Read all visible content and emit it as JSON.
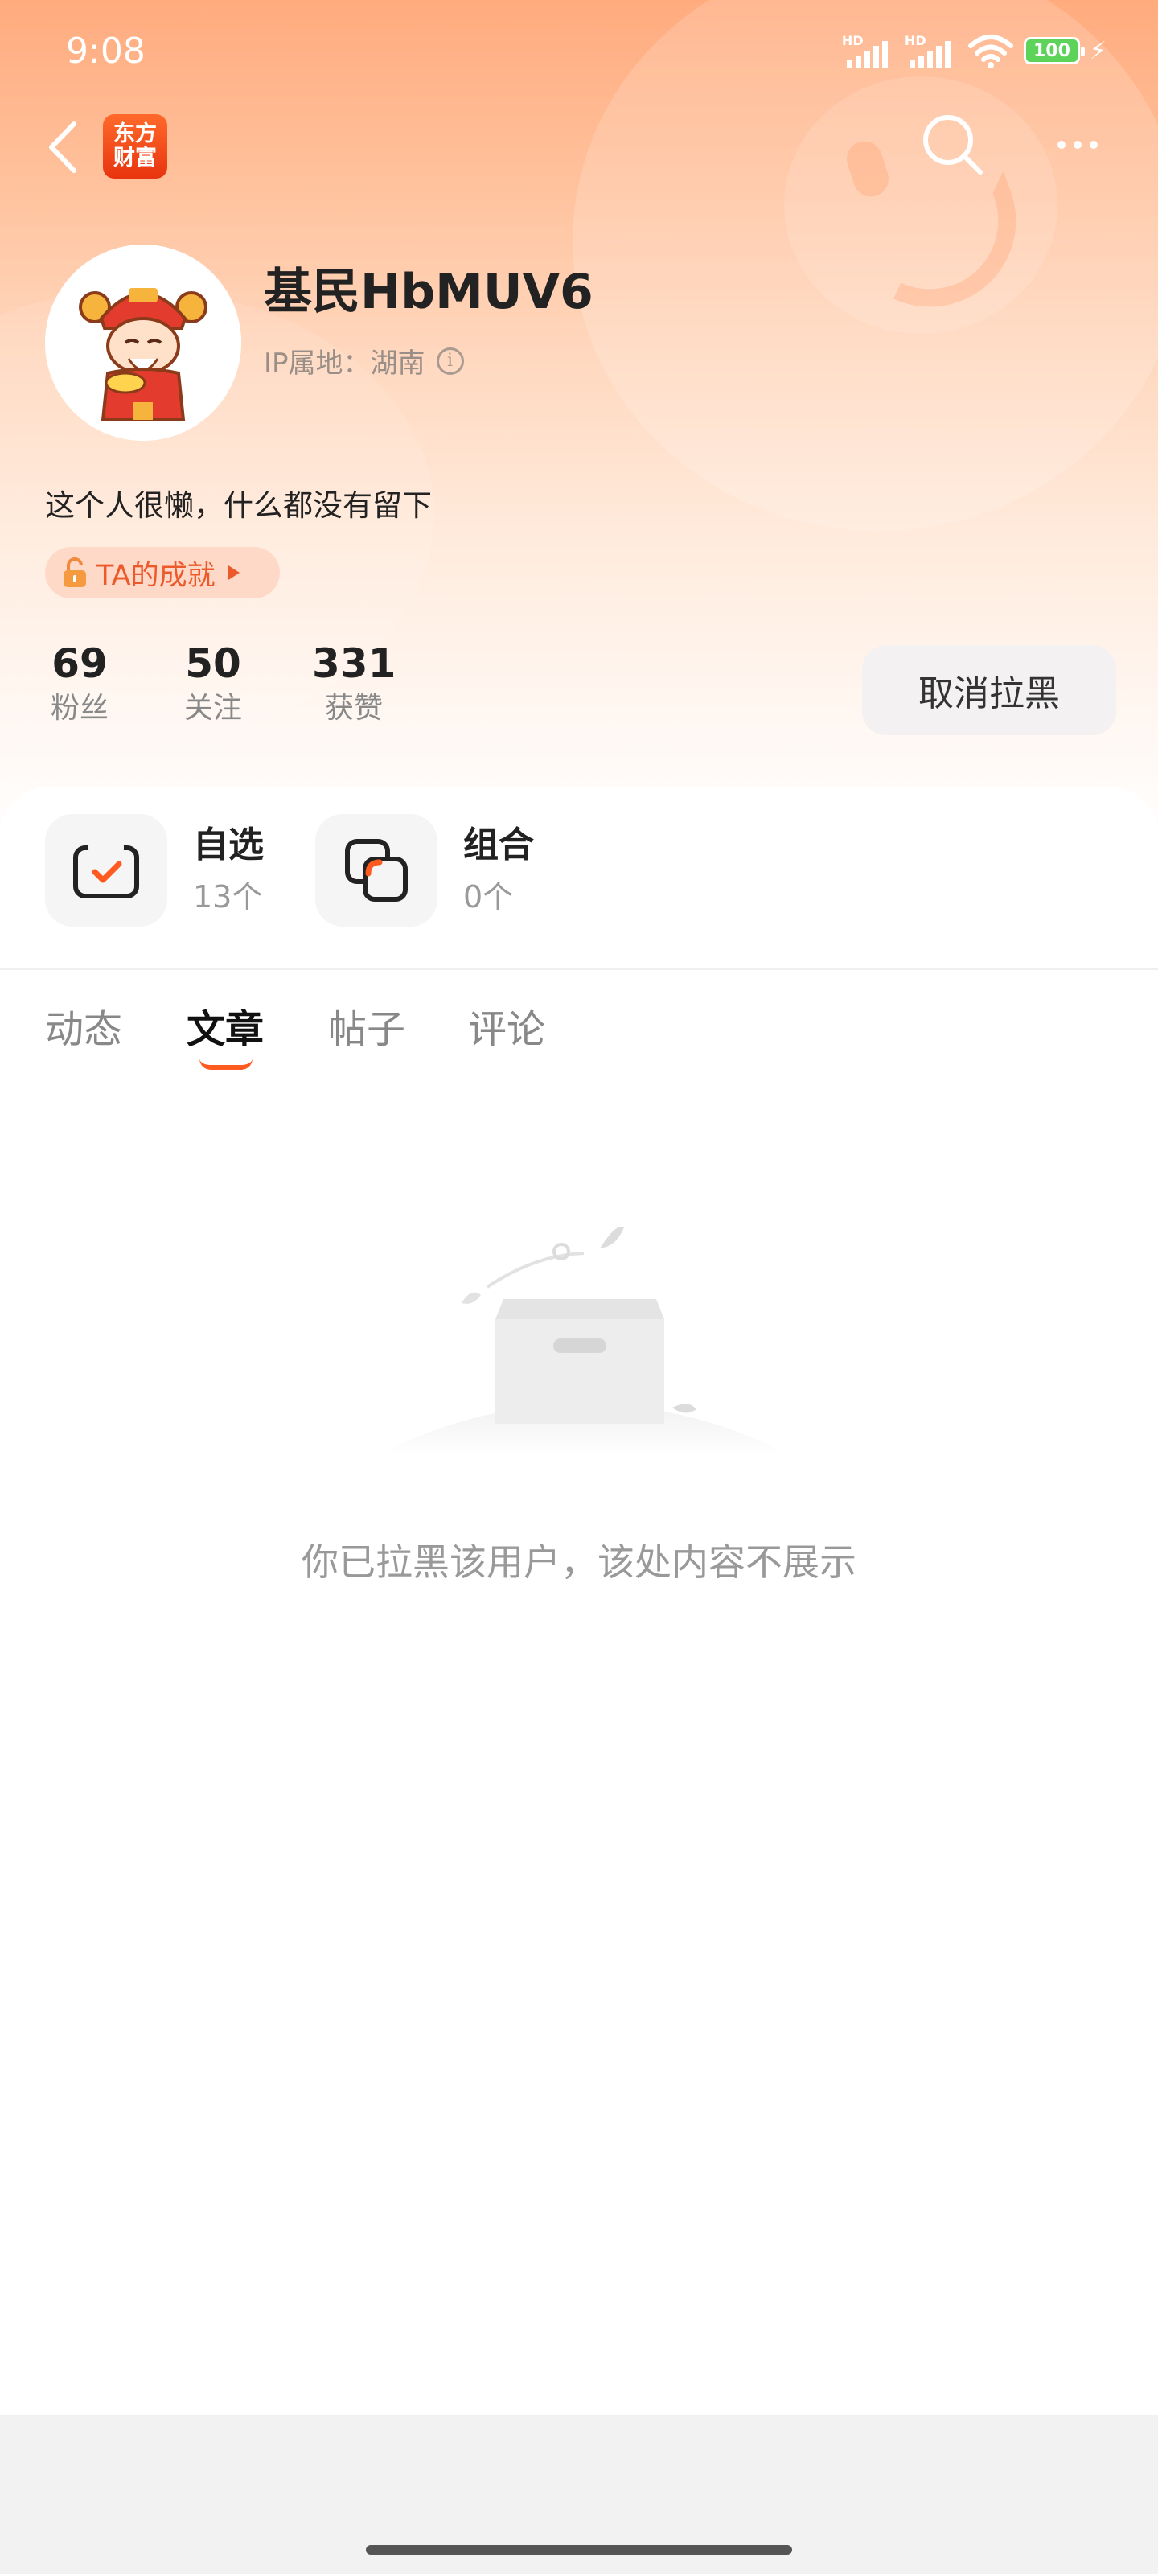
{
  "status_bar": {
    "time": "9:08",
    "signal1_label": "HD",
    "signal2_label": "HD",
    "battery": "100"
  },
  "nav": {
    "back_icon": "chevron-left-icon",
    "logo_line1": "东方",
    "logo_line2": "财富",
    "search_icon": "search-icon",
    "more_icon": "more-icon"
  },
  "profile": {
    "username": "基民HbMUV6",
    "ip_location": "IP属地：湖南",
    "bio": "这个人很懒，什么都没有留下",
    "achievement_label": "TA的成就",
    "stats": [
      {
        "value": "69",
        "label": "粉丝"
      },
      {
        "value": "50",
        "label": "关注"
      },
      {
        "value": "331",
        "label": "获赞"
      }
    ],
    "unblock_label": "取消拉黑"
  },
  "quick_links": [
    {
      "title": "自选",
      "sub": "13个",
      "icon": "check-box-icon"
    },
    {
      "title": "组合",
      "sub": "0个",
      "icon": "portfolio-icon"
    }
  ],
  "tabs": [
    {
      "label": "动态",
      "active": false
    },
    {
      "label": "文章",
      "active": true
    },
    {
      "label": "帖子",
      "active": false
    },
    {
      "label": "评论",
      "active": false
    }
  ],
  "empty_state": {
    "icon": "empty-box-icon",
    "message": "你已拉黑该用户，该处内容不展示"
  },
  "colors": {
    "accent": "#ff5a1f",
    "hero_top": "#ffab7e",
    "achievement_bg": "#ffd9c8"
  }
}
